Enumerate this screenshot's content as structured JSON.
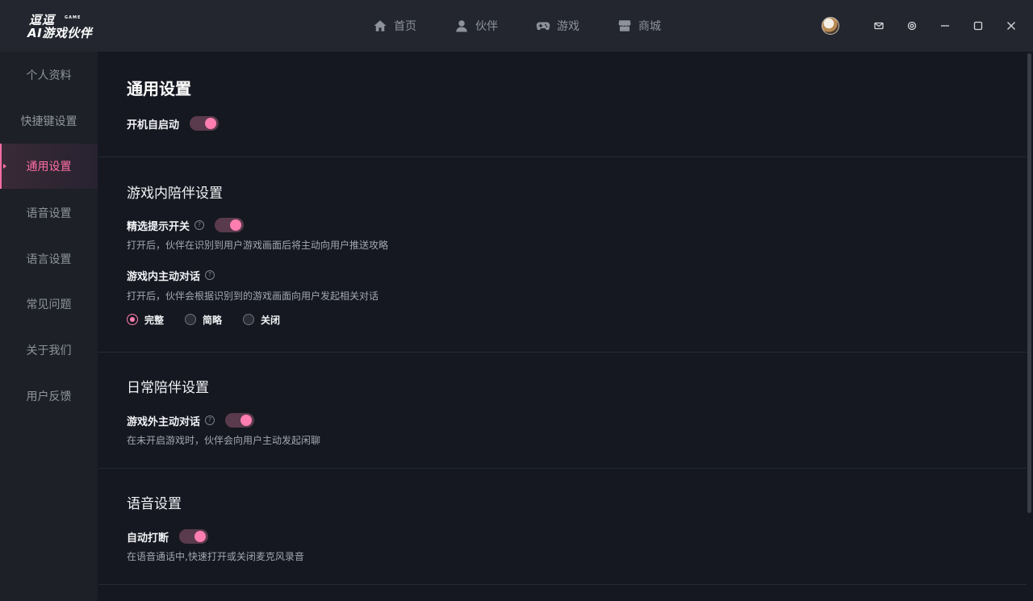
{
  "logo": {
    "line1": "逗逗",
    "line2": "AI游戏伙伴",
    "sub": "GAME"
  },
  "nav": [
    {
      "label": "首页",
      "icon": "home-icon"
    },
    {
      "label": "伙伴",
      "icon": "user-icon"
    },
    {
      "label": "游戏",
      "icon": "gamepad-icon"
    },
    {
      "label": "商城",
      "icon": "store-icon"
    }
  ],
  "window_controls": [
    "mail-icon",
    "settings-icon",
    "minimize-icon",
    "maximize-icon",
    "close-icon"
  ],
  "sidebar": {
    "items": [
      {
        "label": "个人资料"
      },
      {
        "label": "快捷键设置"
      },
      {
        "label": "通用设置",
        "active": true
      },
      {
        "label": "语音设置"
      },
      {
        "label": "语言设置"
      },
      {
        "label": "常见问题"
      },
      {
        "label": "关于我们"
      },
      {
        "label": "用户反馈"
      }
    ]
  },
  "general": {
    "title": "通用设置",
    "autostart": {
      "label": "开机自启动",
      "on": true
    }
  },
  "ingame": {
    "title": "游戏内陪伴设置",
    "tips": {
      "label": "精选提示开关",
      "on": true,
      "desc": "打开后，伙伴在识别到用户游戏画面后将主动向用户推送攻略"
    },
    "dialog": {
      "label": "游戏内主动对话",
      "desc": "打开后，伙伴会根据识别到的游戏画面向用户发起相关对话",
      "options": [
        "完整",
        "简略",
        "关闭"
      ],
      "selected": "完整"
    }
  },
  "daily": {
    "title": "日常陪伴设置",
    "outgame": {
      "label": "游戏外主动对话",
      "on": true,
      "desc": "在未开启游戏时，伙伴会向用户主动发起闲聊"
    }
  },
  "voice": {
    "title": "语音设置",
    "interrupt": {
      "label": "自动打断",
      "on": true,
      "desc": "在语音通话中,快速打开或关闭麦克风录音"
    }
  },
  "colors": {
    "accent": "#ff7eb0",
    "background": "#151820",
    "sidebar": "#1d2027",
    "titlebar": "#23262f"
  }
}
